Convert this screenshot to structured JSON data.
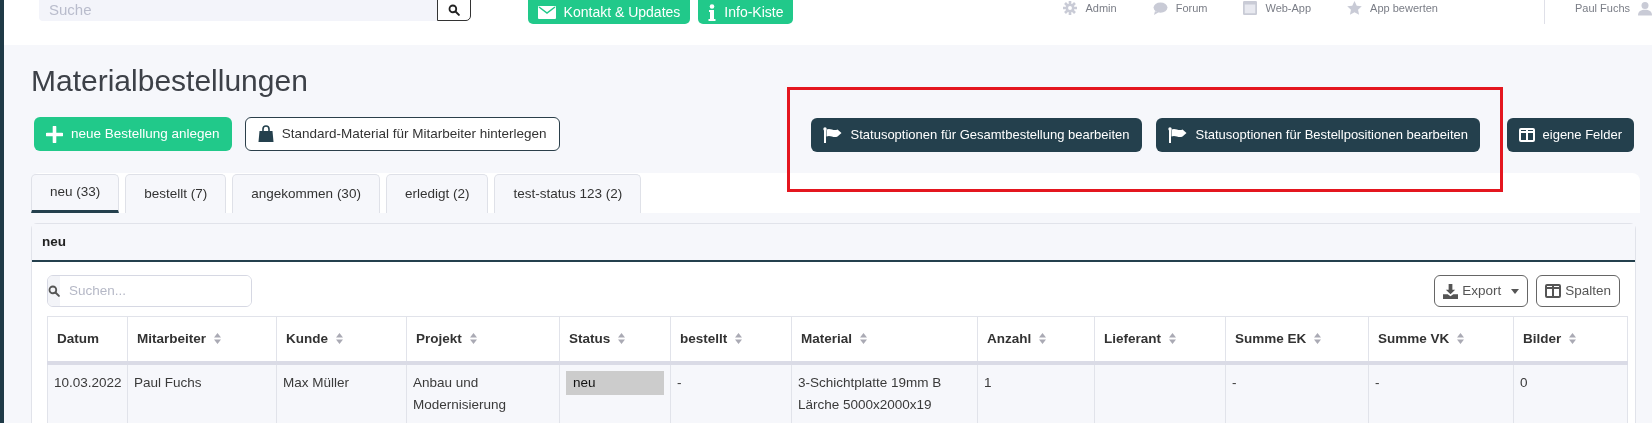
{
  "topbar": {
    "search": {
      "placeholder": "Suche"
    },
    "buttons": [
      {
        "label": "Kontakt & Updates"
      },
      {
        "label": "Info-Kiste"
      }
    ],
    "nav": [
      {
        "label": "Admin"
      },
      {
        "label": "Forum"
      },
      {
        "label": "Web-App"
      },
      {
        "label": "App bewerten"
      }
    ],
    "user": "Paul Fuchs"
  },
  "page": {
    "title": "Materialbestellungen"
  },
  "actions": [
    {
      "label": "neue Bestellung anlegen",
      "kind": "primary"
    },
    {
      "label": "Standard-Material für Mitarbeiter hinterlegen",
      "kind": "outline"
    }
  ],
  "status_actions": {
    "highlighted": true,
    "buttons": [
      {
        "label": "Statusoptionen für Gesamtbestellung bearbeiten"
      },
      {
        "label": "Statusoptionen für Bestellpositionen bearbeiten"
      }
    ]
  },
  "custom_fields_button": "eigene Felder",
  "tabs": [
    {
      "label": "neu (33)",
      "selected": true
    },
    {
      "label": "bestellt (7)",
      "selected": false
    },
    {
      "label": "angekommen (30)",
      "selected": false
    },
    {
      "label": "erledigt (2)",
      "selected": false
    },
    {
      "label": "test-status 123 (2)",
      "selected": false
    }
  ],
  "panel": {
    "title": "neu",
    "search": {
      "placeholder": "Suchen..."
    },
    "export_button": "Export",
    "columns_button": "Spalten"
  },
  "table": {
    "columns": [
      {
        "label": "Datum",
        "sortable": false,
        "kind": "text"
      },
      {
        "label": "Mitarbeiter",
        "sortable": true,
        "kind": "text"
      },
      {
        "label": "Kunde",
        "sortable": true,
        "kind": "text"
      },
      {
        "label": "Projekt",
        "sortable": true,
        "kind": "text"
      },
      {
        "label": "Status",
        "sortable": true,
        "kind": "status"
      },
      {
        "label": "bestellt",
        "sortable": true,
        "kind": "text"
      },
      {
        "label": "Material",
        "sortable": true,
        "kind": "text"
      },
      {
        "label": "Anzahl",
        "sortable": true,
        "kind": "text"
      },
      {
        "label": "Lieferant",
        "sortable": true,
        "kind": "text"
      },
      {
        "label": "Summe EK",
        "sortable": true,
        "kind": "text"
      },
      {
        "label": "Summe VK",
        "sortable": true,
        "kind": "text"
      },
      {
        "label": "Bilder",
        "sortable": true,
        "kind": "text"
      }
    ],
    "rows": [
      {
        "cells": [
          "10.03.2022",
          "Paul Fuchs",
          "Max Müller",
          "Anbau und Modernisierung",
          "neu",
          "-",
          "3-Schichtplatte 19mm B Lärche 5000x2000x19",
          "1",
          "",
          "-",
          "-",
          "0"
        ]
      }
    ]
  }
}
